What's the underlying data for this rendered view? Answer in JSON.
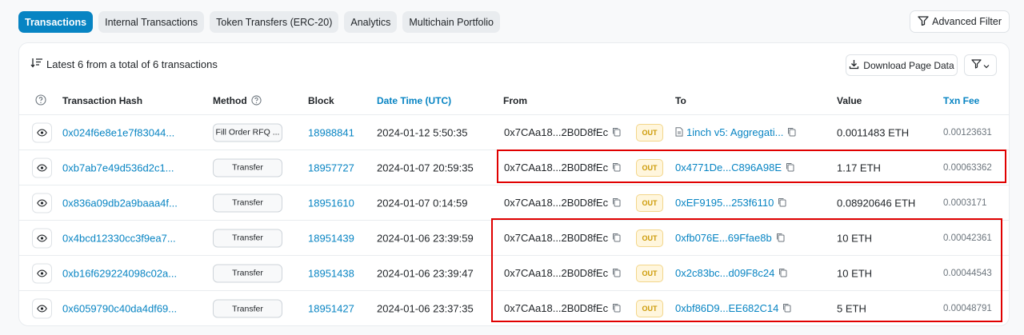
{
  "tabs": [
    {
      "label": "Transactions"
    },
    {
      "label": "Internal Transactions"
    },
    {
      "label": "Token Transfers (ERC-20)"
    },
    {
      "label": "Analytics"
    },
    {
      "label": "Multichain Portfolio"
    }
  ],
  "advanced_filter_label": "Advanced Filter",
  "summary": "Latest 6 from a total of 6 transactions",
  "download_label": "Download Page Data",
  "columns": {
    "hash": "Transaction Hash",
    "method": "Method",
    "block": "Block",
    "datetime": "Date Time (UTC)",
    "from": "From",
    "to": "To",
    "value": "Value",
    "fee": "Txn Fee"
  },
  "rows": [
    {
      "hash": "0x024f6e8e1e7f83044...",
      "method": "Fill Order RFQ ...",
      "block": "18988841",
      "datetime": "2024-01-12 5:50:35",
      "from": "0x7CAa18...2B0D8fEc",
      "direction": "OUT",
      "to": "1inch v5: Aggregati...",
      "value": "0.0011483 ETH",
      "fee": "0.00123631"
    },
    {
      "hash": "0xb7ab7e49d536d2c1...",
      "method": "Transfer",
      "block": "18957727",
      "datetime": "2024-01-07 20:59:35",
      "from": "0x7CAa18...2B0D8fEc",
      "direction": "OUT",
      "to": "0x4771De...C896A98E",
      "value": "1.17 ETH",
      "fee": "0.00063362"
    },
    {
      "hash": "0x836a09db2a9baaa4f...",
      "method": "Transfer",
      "block": "18951610",
      "datetime": "2024-01-07 0:14:59",
      "from": "0x7CAa18...2B0D8fEc",
      "direction": "OUT",
      "to": "0xEF9195...253f6110",
      "value": "0.08920646 ETH",
      "fee": "0.0003171"
    },
    {
      "hash": "0x4bcd12330cc3f9ea7...",
      "method": "Transfer",
      "block": "18951439",
      "datetime": "2024-01-06 23:39:59",
      "from": "0x7CAa18...2B0D8fEc",
      "direction": "OUT",
      "to": "0xfb076E...69Ffae8b",
      "value": "10 ETH",
      "fee": "0.00042361"
    },
    {
      "hash": "0xb16f629224098c02a...",
      "method": "Transfer",
      "block": "18951438",
      "datetime": "2024-01-06 23:39:47",
      "from": "0x7CAa18...2B0D8fEc",
      "direction": "OUT",
      "to": "0x2c83bc...d09F8c24",
      "value": "10 ETH",
      "fee": "0.00044543"
    },
    {
      "hash": "0x6059790c40da4df69...",
      "method": "Transfer",
      "block": "18951427",
      "datetime": "2024-01-06 23:37:35",
      "from": "0x7CAa18...2B0D8fEc",
      "direction": "OUT",
      "to": "0xbf86D9...EE682C14",
      "value": "5 ETH",
      "fee": "0.00048791"
    }
  ],
  "colors": {
    "link": "#0784c3",
    "highlight": "#e00000",
    "out_badge": "#cc9a06"
  }
}
